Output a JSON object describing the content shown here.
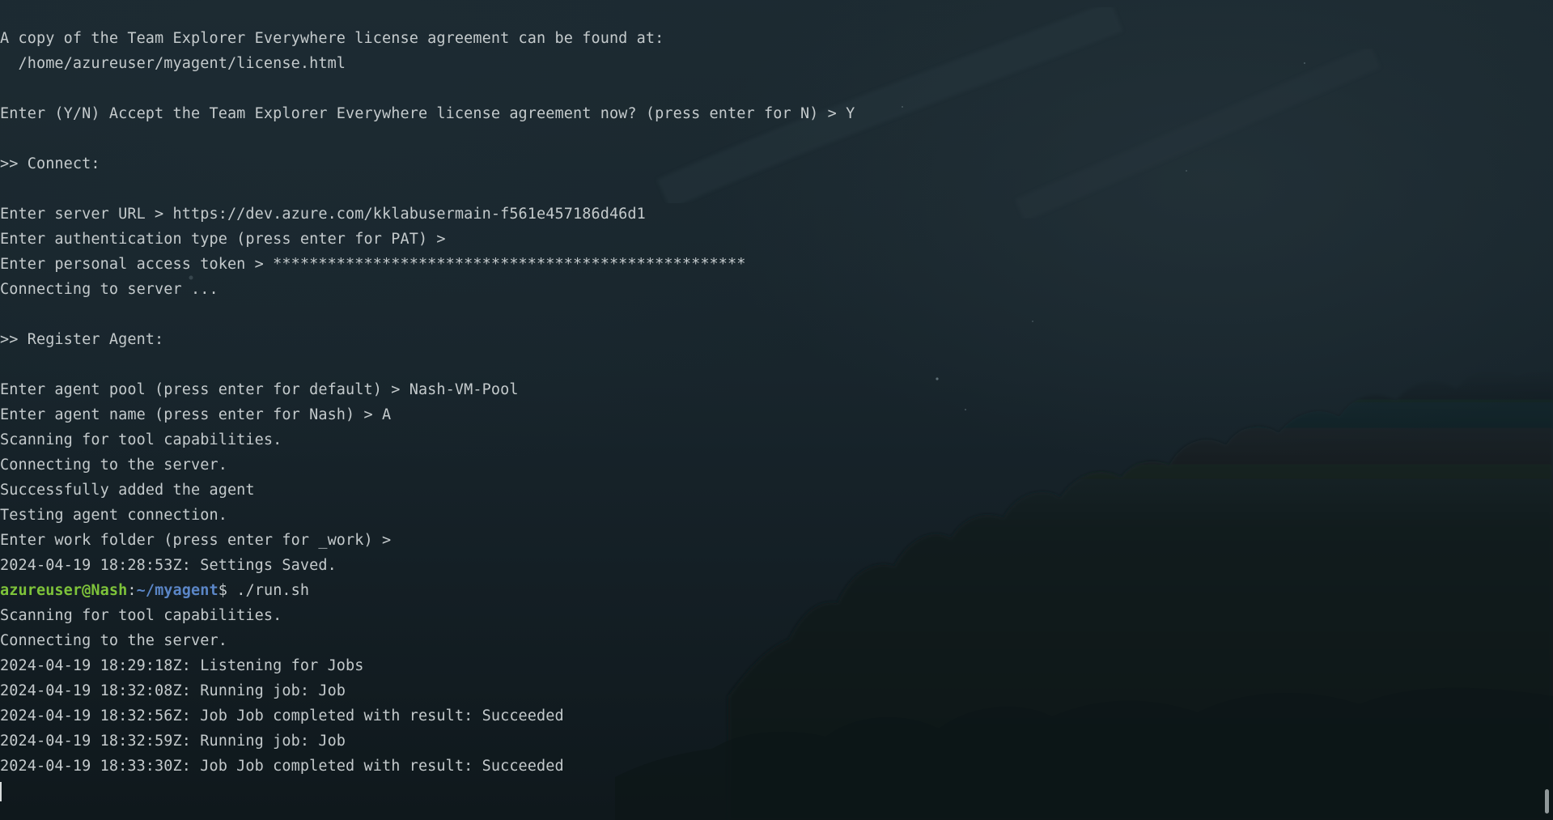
{
  "terminal": {
    "lines": [
      {
        "text": "A copy of the Team Explorer Everywhere license agreement can be found at:"
      },
      {
        "text": "  /home/azureuser/myagent/license.html"
      },
      {
        "text": ""
      },
      {
        "text": "Enter (Y/N) Accept the Team Explorer Everywhere license agreement now? (press enter for N) > Y"
      },
      {
        "text": ""
      },
      {
        "text": ">> Connect:"
      },
      {
        "text": ""
      },
      {
        "text": "Enter server URL > https://dev.azure.com/kklabusermain-f561e457186d46d1"
      },
      {
        "text": "Enter authentication type (press enter for PAT) >"
      },
      {
        "text": "Enter personal access token > ****************************************************"
      },
      {
        "text": "Connecting to server ..."
      },
      {
        "text": ""
      },
      {
        "text": ">> Register Agent:"
      },
      {
        "text": ""
      },
      {
        "text": "Enter agent pool (press enter for default) > Nash-VM-Pool"
      },
      {
        "text": "Enter agent name (press enter for Nash) > A"
      },
      {
        "text": "Scanning for tool capabilities."
      },
      {
        "text": "Connecting to the server."
      },
      {
        "text": "Successfully added the agent"
      },
      {
        "text": "Testing agent connection."
      },
      {
        "text": "Enter work folder (press enter for _work) >"
      },
      {
        "text": "2024-04-19 18:28:53Z: Settings Saved."
      },
      {
        "prompt": {
          "user": "azureuser@Nash",
          "sep": ":",
          "path": "~/myagent",
          "symbol": "$",
          "command": " ./run.sh"
        }
      },
      {
        "text": "Scanning for tool capabilities."
      },
      {
        "text": "Connecting to the server."
      },
      {
        "text": "2024-04-19 18:29:18Z: Listening for Jobs"
      },
      {
        "text": "2024-04-19 18:32:08Z: Running job: Job"
      },
      {
        "text": "2024-04-19 18:32:56Z: Job Job completed with result: Succeeded"
      },
      {
        "text": "2024-04-19 18:32:59Z: Running job: Job"
      },
      {
        "text": "2024-04-19 18:33:30Z: Job Job completed with result: Succeeded"
      }
    ]
  },
  "colors": {
    "text": "#c4cacc",
    "prompt_user": "#7ec33a",
    "prompt_path": "#5b86c7",
    "background": "#18252c"
  }
}
